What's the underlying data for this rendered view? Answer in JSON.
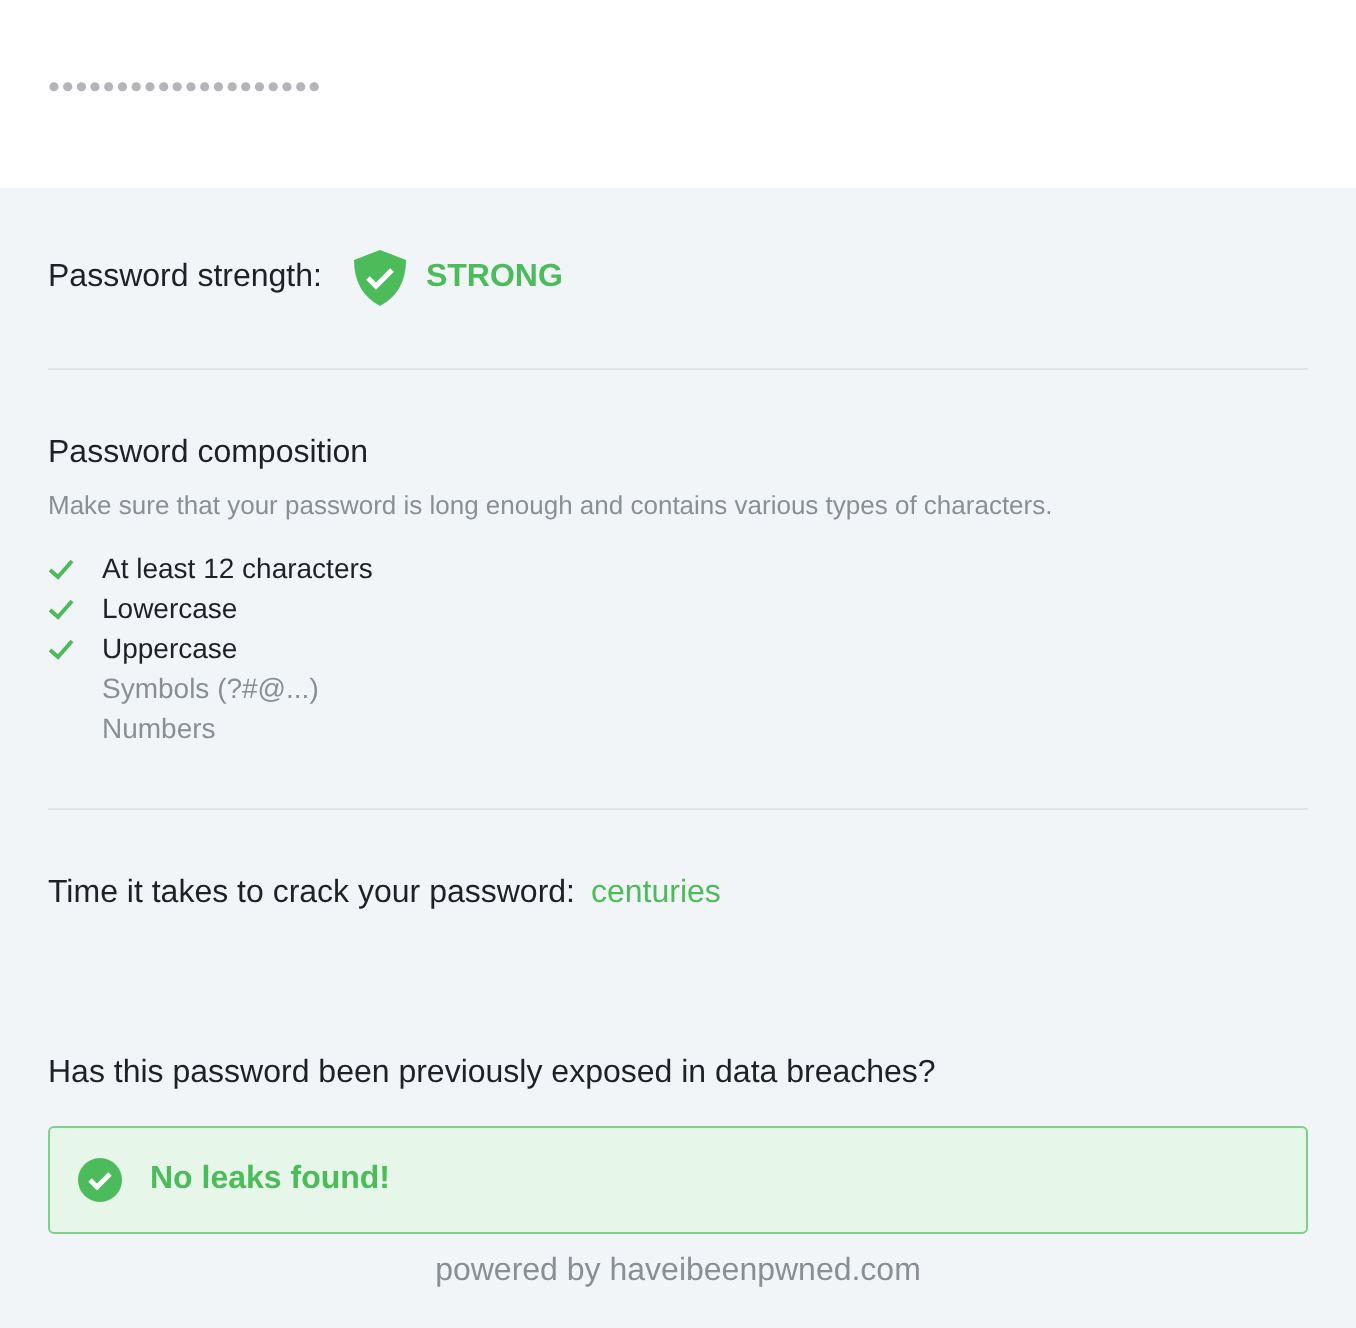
{
  "password_field": {
    "value": "••••••••••••••••••••"
  },
  "strength": {
    "label": "Password strength:",
    "value": "STRONG"
  },
  "composition": {
    "title": "Password composition",
    "description": "Make sure that your password is long enough and contains various types of characters.",
    "requirements": [
      {
        "label": "At least 12 characters",
        "checked": true
      },
      {
        "label": "Lowercase",
        "checked": true
      },
      {
        "label": "Uppercase",
        "checked": true
      },
      {
        "label": "Symbols (?#@...)",
        "checked": false
      },
      {
        "label": "Numbers",
        "checked": false
      }
    ]
  },
  "crack_time": {
    "label": "Time it takes to crack your password:",
    "value": "centuries"
  },
  "breach": {
    "question": "Has this password been previously exposed in data breaches?",
    "result": "No leaks found!"
  },
  "footer": "powered by haveibeenpwned.com"
}
